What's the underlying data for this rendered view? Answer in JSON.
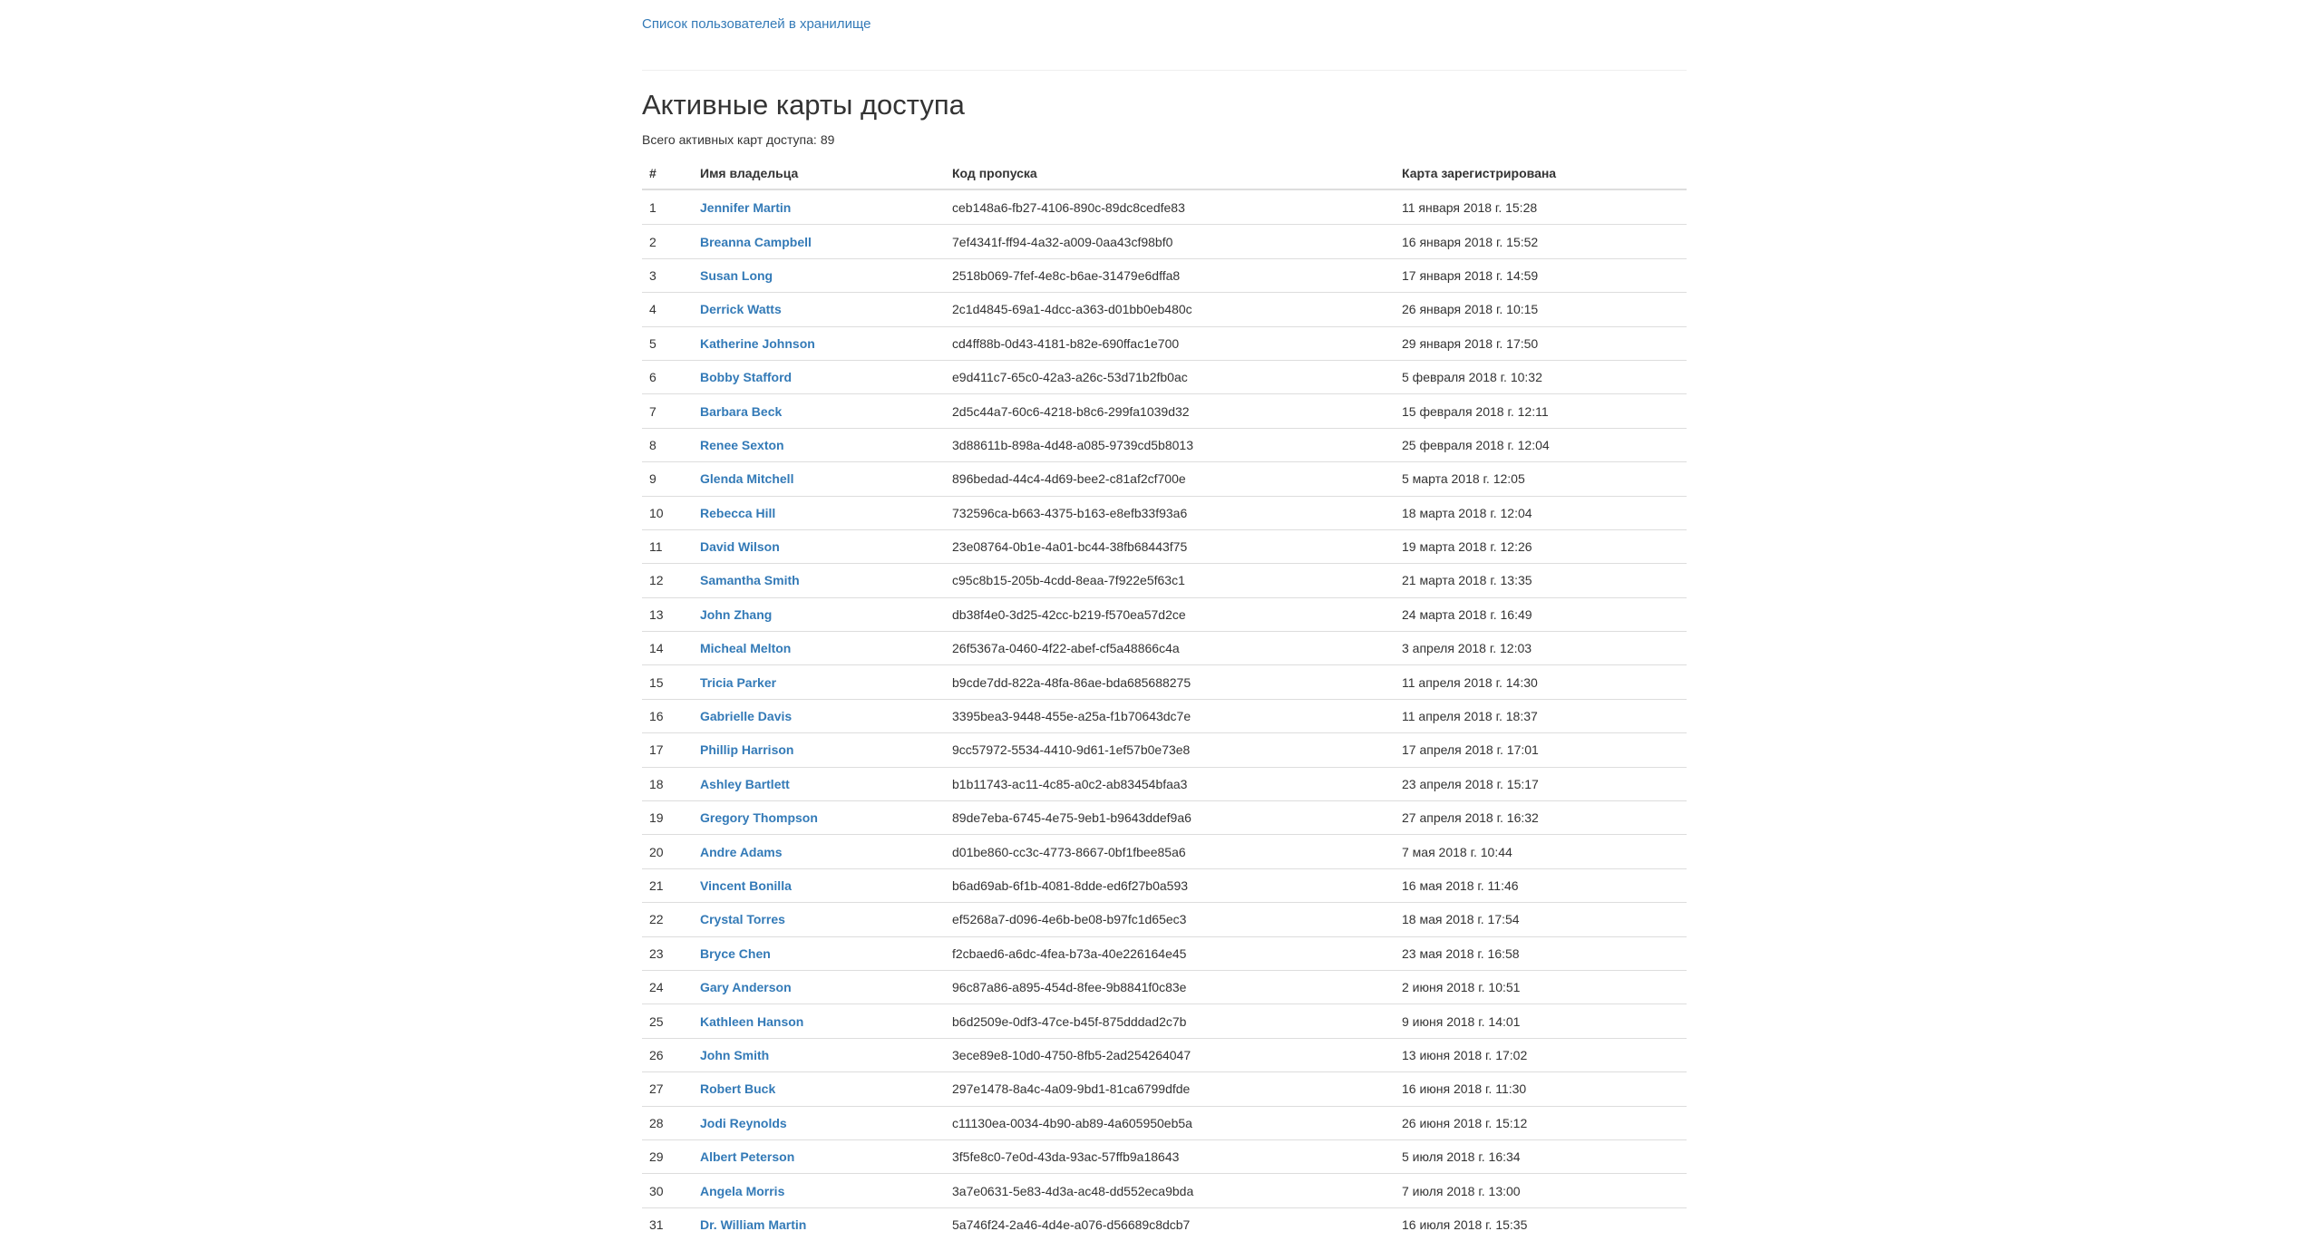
{
  "top_link": "Список пользователей в хранилище",
  "page_title": "Активные карты доступа",
  "total": {
    "label": "Всего активных карт доступа:",
    "count": "89"
  },
  "table": {
    "headers": {
      "num": "#",
      "owner": "Имя владельца",
      "code": "Код пропуска",
      "date": "Карта зарегистрирована"
    },
    "rows": [
      {
        "num": "1",
        "owner": "Jennifer Martin",
        "code": "ceb148a6-fb27-4106-890c-89dc8cedfe83",
        "date": "11 января 2018 г. 15:28"
      },
      {
        "num": "2",
        "owner": "Breanna Campbell",
        "code": "7ef4341f-ff94-4a32-a009-0aa43cf98bf0",
        "date": "16 января 2018 г. 15:52"
      },
      {
        "num": "3",
        "owner": "Susan Long",
        "code": "2518b069-7fef-4e8c-b6ae-31479e6dffa8",
        "date": "17 января 2018 г. 14:59"
      },
      {
        "num": "4",
        "owner": "Derrick Watts",
        "code": "2c1d4845-69a1-4dcc-a363-d01bb0eb480c",
        "date": "26 января 2018 г. 10:15"
      },
      {
        "num": "5",
        "owner": "Katherine Johnson",
        "code": "cd4ff88b-0d43-4181-b82e-690ffac1e700",
        "date": "29 января 2018 г. 17:50"
      },
      {
        "num": "6",
        "owner": "Bobby Stafford",
        "code": "e9d411c7-65c0-42a3-a26c-53d71b2fb0ac",
        "date": "5 февраля 2018 г. 10:32"
      },
      {
        "num": "7",
        "owner": "Barbara Beck",
        "code": "2d5c44a7-60c6-4218-b8c6-299fa1039d32",
        "date": "15 февраля 2018 г. 12:11"
      },
      {
        "num": "8",
        "owner": "Renee Sexton",
        "code": "3d88611b-898a-4d48-a085-9739cd5b8013",
        "date": "25 февраля 2018 г. 12:04"
      },
      {
        "num": "9",
        "owner": "Glenda Mitchell",
        "code": "896bedad-44c4-4d69-bee2-c81af2cf700e",
        "date": "5 марта 2018 г. 12:05"
      },
      {
        "num": "10",
        "owner": "Rebecca Hill",
        "code": "732596ca-b663-4375-b163-e8efb33f93a6",
        "date": "18 марта 2018 г. 12:04"
      },
      {
        "num": "11",
        "owner": "David Wilson",
        "code": "23e08764-0b1e-4a01-bc44-38fb68443f75",
        "date": "19 марта 2018 г. 12:26"
      },
      {
        "num": "12",
        "owner": "Samantha Smith",
        "code": "c95c8b15-205b-4cdd-8eaa-7f922e5f63c1",
        "date": "21 марта 2018 г. 13:35"
      },
      {
        "num": "13",
        "owner": "John Zhang",
        "code": "db38f4e0-3d25-42cc-b219-f570ea57d2ce",
        "date": "24 марта 2018 г. 16:49"
      },
      {
        "num": "14",
        "owner": "Micheal Melton",
        "code": "26f5367a-0460-4f22-abef-cf5a48866c4a",
        "date": "3 апреля 2018 г. 12:03"
      },
      {
        "num": "15",
        "owner": "Tricia Parker",
        "code": "b9cde7dd-822a-48fa-86ae-bda685688275",
        "date": "11 апреля 2018 г. 14:30"
      },
      {
        "num": "16",
        "owner": "Gabrielle Davis",
        "code": "3395bea3-9448-455e-a25a-f1b70643dc7e",
        "date": "11 апреля 2018 г. 18:37"
      },
      {
        "num": "17",
        "owner": "Phillip Harrison",
        "code": "9cc57972-5534-4410-9d61-1ef57b0e73e8",
        "date": "17 апреля 2018 г. 17:01"
      },
      {
        "num": "18",
        "owner": "Ashley Bartlett",
        "code": "b1b11743-ac11-4c85-a0c2-ab83454bfaa3",
        "date": "23 апреля 2018 г. 15:17"
      },
      {
        "num": "19",
        "owner": "Gregory Thompson",
        "code": "89de7eba-6745-4e75-9eb1-b9643ddef9a6",
        "date": "27 апреля 2018 г. 16:32"
      },
      {
        "num": "20",
        "owner": "Andre Adams",
        "code": "d01be860-cc3c-4773-8667-0bf1fbee85a6",
        "date": "7 мая 2018 г. 10:44"
      },
      {
        "num": "21",
        "owner": "Vincent Bonilla",
        "code": "b6ad69ab-6f1b-4081-8dde-ed6f27b0a593",
        "date": "16 мая 2018 г. 11:46"
      },
      {
        "num": "22",
        "owner": "Crystal Torres",
        "code": "ef5268a7-d096-4e6b-be08-b97fc1d65ec3",
        "date": "18 мая 2018 г. 17:54"
      },
      {
        "num": "23",
        "owner": "Bryce Chen",
        "code": "f2cbaed6-a6dc-4fea-b73a-40e226164e45",
        "date": "23 мая 2018 г. 16:58"
      },
      {
        "num": "24",
        "owner": "Gary Anderson",
        "code": "96c87a86-a895-454d-8fee-9b8841f0c83e",
        "date": "2 июня 2018 г. 10:51"
      },
      {
        "num": "25",
        "owner": "Kathleen Hanson",
        "code": "b6d2509e-0df3-47ce-b45f-875dddad2c7b",
        "date": "9 июня 2018 г. 14:01"
      },
      {
        "num": "26",
        "owner": "John Smith",
        "code": "3ece89e8-10d0-4750-8fb5-2ad254264047",
        "date": "13 июня 2018 г. 17:02"
      },
      {
        "num": "27",
        "owner": "Robert Buck",
        "code": "297e1478-8a4c-4a09-9bd1-81ca6799dfde",
        "date": "16 июня 2018 г. 11:30"
      },
      {
        "num": "28",
        "owner": "Jodi Reynolds",
        "code": "c11130ea-0034-4b90-ab89-4a605950eb5a",
        "date": "26 июня 2018 г. 15:12"
      },
      {
        "num": "29",
        "owner": "Albert Peterson",
        "code": "3f5fe8c0-7e0d-43da-93ac-57ffb9a18643",
        "date": "5 июля 2018 г. 16:34"
      },
      {
        "num": "30",
        "owner": "Angela Morris",
        "code": "3a7e0631-5e83-4d3a-ac48-dd552eca9bda",
        "date": "7 июля 2018 г. 13:00"
      },
      {
        "num": "31",
        "owner": "Dr. William Martin",
        "code": "5a746f24-2a46-4d4e-a076-d56689c8dcb7",
        "date": "16 июля 2018 г. 15:35"
      }
    ]
  }
}
